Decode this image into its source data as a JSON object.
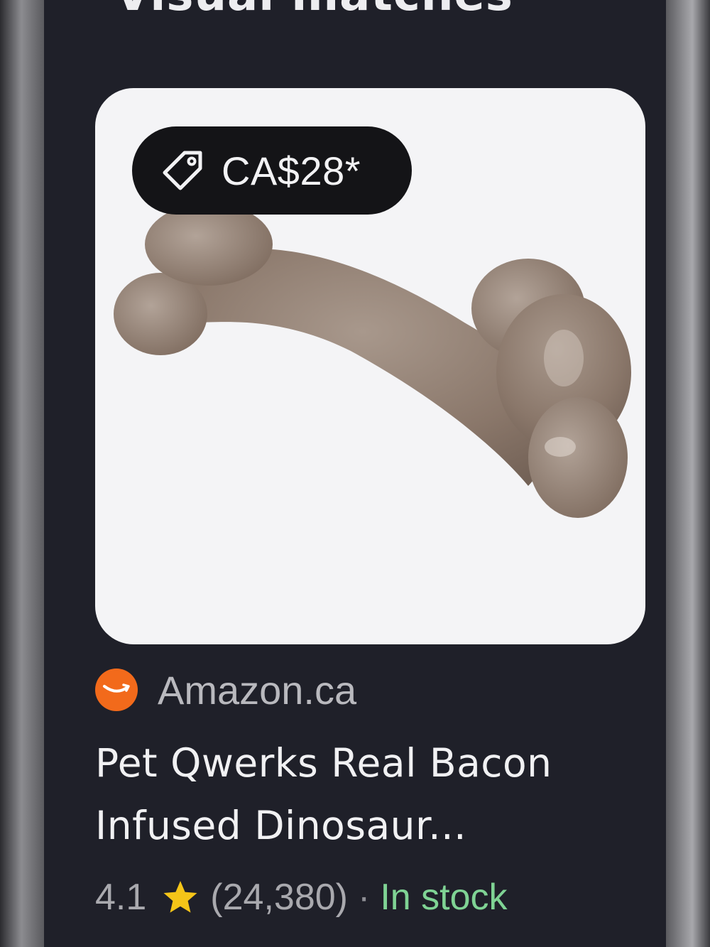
{
  "section": {
    "title": "Visual matches"
  },
  "card": {
    "price": "CA$28*",
    "source": {
      "name": "Amazon.ca",
      "logo_color": "#f26a1b"
    },
    "title": "Pet Qwerks Real Bacon Infused Dinosaur...",
    "rating": "4.1",
    "review_count": "(24,380)",
    "separator": "·",
    "availability": "In stock",
    "availability_color": "#7fd394",
    "star_color": "#f5c518",
    "image_icon": "dog-bone-chew-toy"
  }
}
